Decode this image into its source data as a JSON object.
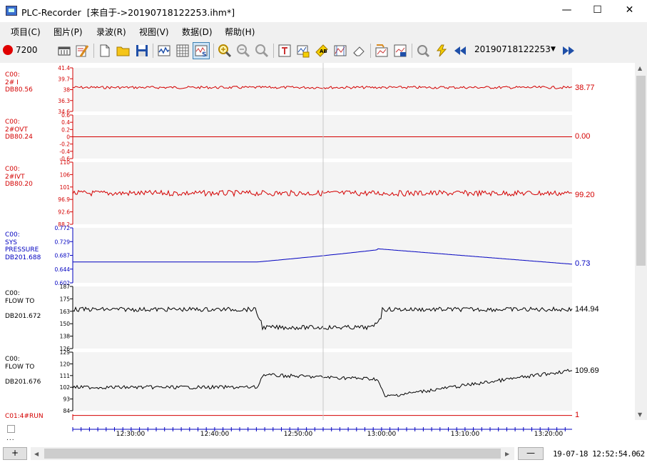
{
  "window": {
    "title": "PLC-Recorder  [来自于->20190718122253.ihm*]",
    "minimize": "—",
    "maximize": "☐",
    "close": "✕"
  },
  "menu": [
    "项目(C)",
    "图片(P)",
    "录波(R)",
    "视图(V)",
    "数据(D)",
    "帮助(H)"
  ],
  "toolbar": {
    "record_count": "7200",
    "file_select": "20190718122253",
    "record_color": "#e00000"
  },
  "channels": [
    {
      "label": "C00:\n2# I\nDB80.56",
      "color": "#d40000",
      "value": "38.77",
      "ticks": [
        "41.4",
        "39.7",
        "38",
        "36.3",
        "34.6"
      ]
    },
    {
      "label": "C00:\n2#OVT\nDB80.24",
      "color": "#d40000",
      "value": "0.00",
      "ticks": [
        "0.6",
        "0.4",
        "0.2",
        "0",
        "-0.2",
        "-0.4",
        "-0.6"
      ]
    },
    {
      "label": "C00:\n2#IVT\nDB80.20",
      "color": "#d40000",
      "value": "99.20",
      "ticks": [
        "110",
        "106",
        "101",
        "96.9",
        "92.6",
        "88.2"
      ]
    },
    {
      "label": "C00:\nSYS\nPRESSURE\nDB201.688",
      "color": "#0000c0",
      "value": "0.73",
      "ticks": [
        "0.772",
        "0.729",
        "0.687",
        "0.644",
        "0.602"
      ]
    },
    {
      "label": "C00:\nFLOW TO\n\nDB201.672",
      "color": "#000000",
      "value": "144.94",
      "ticks": [
        "187",
        "175",
        "163",
        "150",
        "138",
        "126"
      ]
    },
    {
      "label": "C00:\nFLOW TO\n\nDB201.676",
      "color": "#000000",
      "value": "109.69",
      "ticks": [
        "129",
        "120",
        "111",
        "102",
        "93",
        "84"
      ]
    },
    {
      "label": "C01:4#RUN",
      "color": "#d40000",
      "value": "1",
      "ticks": []
    }
  ],
  "time_axis": [
    "12:30:00",
    "12:40:00",
    "12:50:00",
    "13:00:00",
    "13:10:00",
    "13:20:00"
  ],
  "footer": {
    "dots": "...",
    "plus": "+",
    "minus": "—",
    "timestamp": "19-07-18 12:52:54.062"
  }
}
